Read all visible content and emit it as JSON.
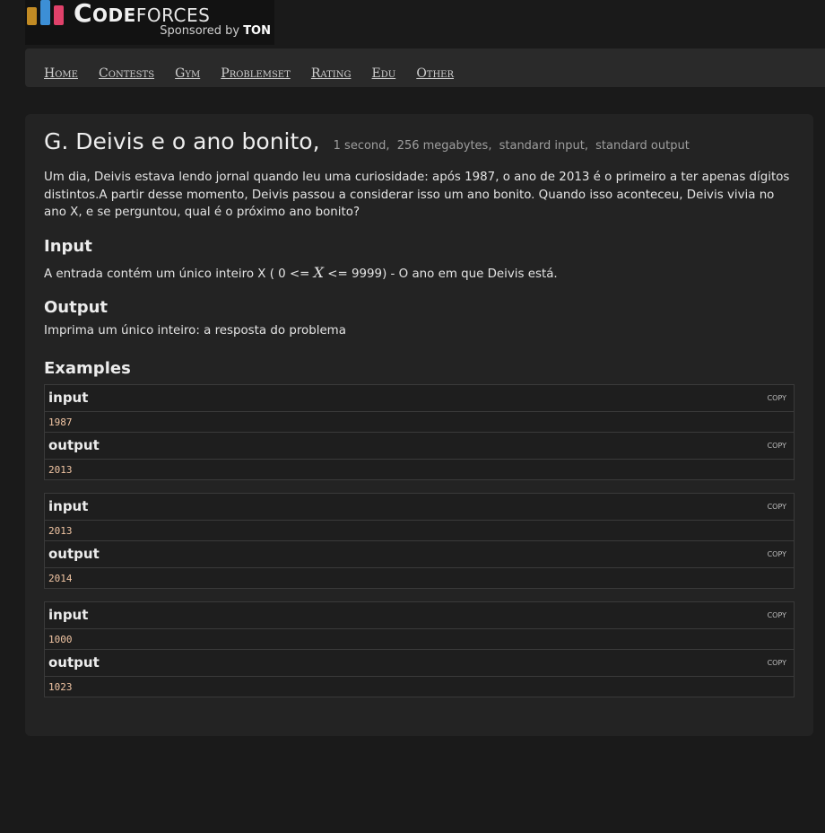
{
  "logo": {
    "word_code": "Code",
    "word_forces": "forces",
    "sponsor_prefix": "Sponsored by",
    "sponsor_name": "TON"
  },
  "menu": {
    "items": [
      "Home",
      "Contests",
      "Gym",
      "Problemset",
      "Rating",
      "Edu",
      "Other"
    ]
  },
  "problem": {
    "title": "G. Deivis e o ano bonito,",
    "time_limit": "1 second,",
    "memory_limit": "256 megabytes,",
    "input_file": "standard input,",
    "output_file": "standard output",
    "statement": "Um dia, Deivis estava lendo jornal quando leu uma curiosidade: após 1987, o ano de 2013 é o primeiro a ter apenas dígitos distintos.A partir desse momento, Deivis passou a considerar isso um ano bonito. Quando isso aconteceu, Deivis vivia no ano X, e se perguntou, qual é o próximo ano bonito?",
    "input_title": "Input",
    "input_text_pre": "A entrada contém um único inteiro X ( 0 <= ",
    "input_var": "X",
    "input_text_post": " <= 9999) - O ano em que Deivis está.",
    "output_title": "Output",
    "output_text": "Imprima um único inteiro: a resposta do problema",
    "examples_title": "Examples"
  },
  "examples": [
    {
      "input_label": "input",
      "input": "1987",
      "output_label": "output",
      "output": "2013",
      "copy": "COPY"
    },
    {
      "input_label": "input",
      "input": "2013",
      "output_label": "output",
      "output": "2014",
      "copy": "COPY"
    },
    {
      "input_label": "input",
      "input": "1000",
      "output_label": "output",
      "output": "1023",
      "copy": "COPY"
    }
  ]
}
